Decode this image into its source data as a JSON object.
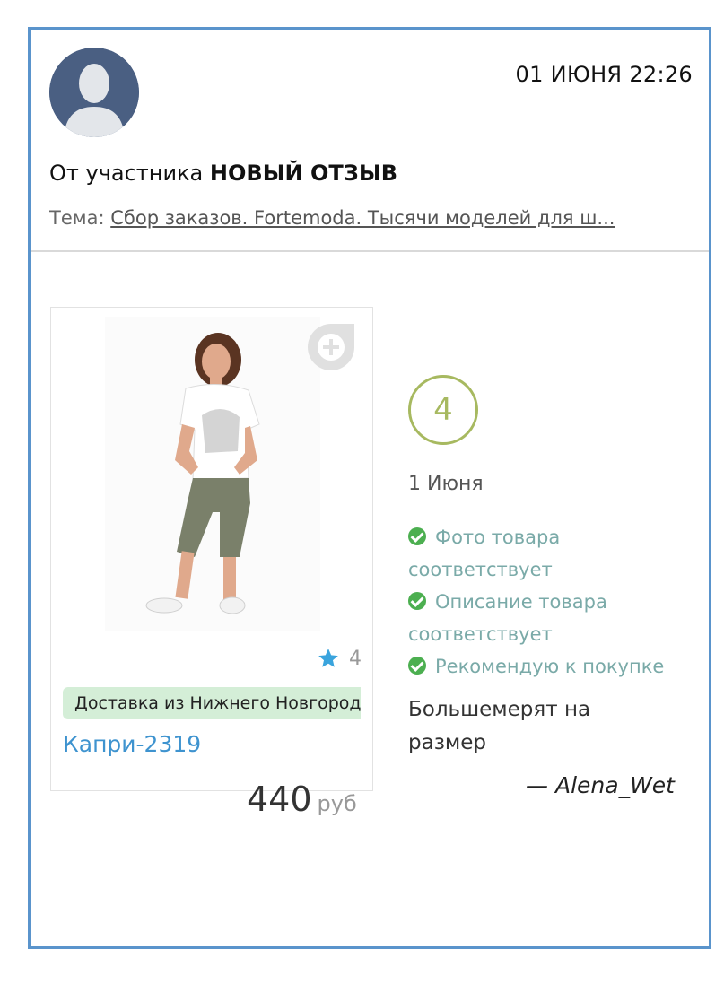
{
  "header": {
    "timestamp": "01 ИЮНЯ 22:26",
    "from_prefix": "От участника",
    "from_name": "НОВЫЙ ОТЗЫВ",
    "topic_label": "Тема:",
    "topic_link": "Сбор заказов. Fortemoda. Тысячи моделей для ш..."
  },
  "product": {
    "rating_value": "4",
    "delivery": "Доставка из Нижнего Новгорода",
    "name": "Капри-2319",
    "price": "440",
    "currency": "руб"
  },
  "review": {
    "score": "4",
    "date": "1 Июня",
    "checks": [
      "Фото товара соответствует",
      "Описание товара соответствует",
      "Рекомендую к покупке"
    ],
    "text": "Большемерят на размер",
    "author": "— Alena_Wet"
  },
  "colors": {
    "border": "#5a94cc",
    "link": "#3e93cf",
    "score": "#a7b960",
    "check": "#4caf50",
    "badge": "#d4eed7"
  }
}
